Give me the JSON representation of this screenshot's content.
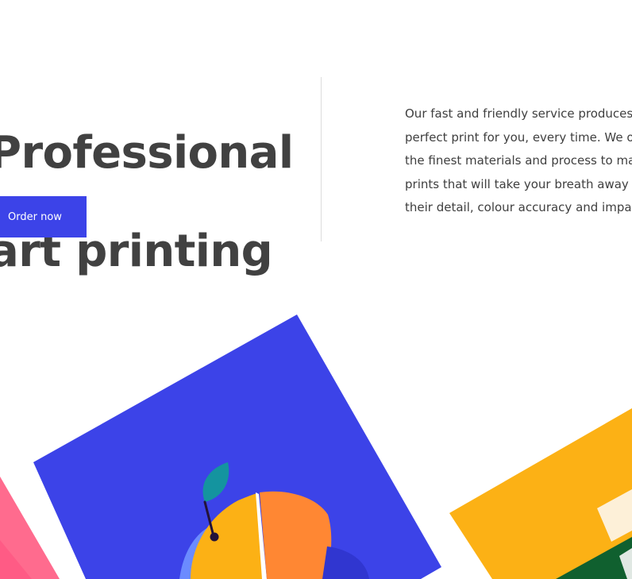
{
  "hero": {
    "title_lines": [
      "Professional",
      "art printing"
    ],
    "cta_label": "Order now"
  },
  "intro": {
    "lines": [
      "Our fast and friendly service produces t",
      "perfect print for you, every time. We onl",
      "the finest materials and process to mak",
      "prints that will take your breath away w",
      "their detail, colour accuracy and impac"
    ]
  },
  "colors": {
    "accent_blue": "#3c43e8",
    "orange": "#ff8733",
    "yellow": "#fcb115",
    "pink": "#ff6b8e",
    "teal": "#14949f"
  },
  "artwork": {
    "pink_print": "pink-print-icon",
    "blue_print": "blue-print-icon",
    "fruit": "orange-fruit-icon",
    "yellow_print": "yellow-print-icon"
  }
}
